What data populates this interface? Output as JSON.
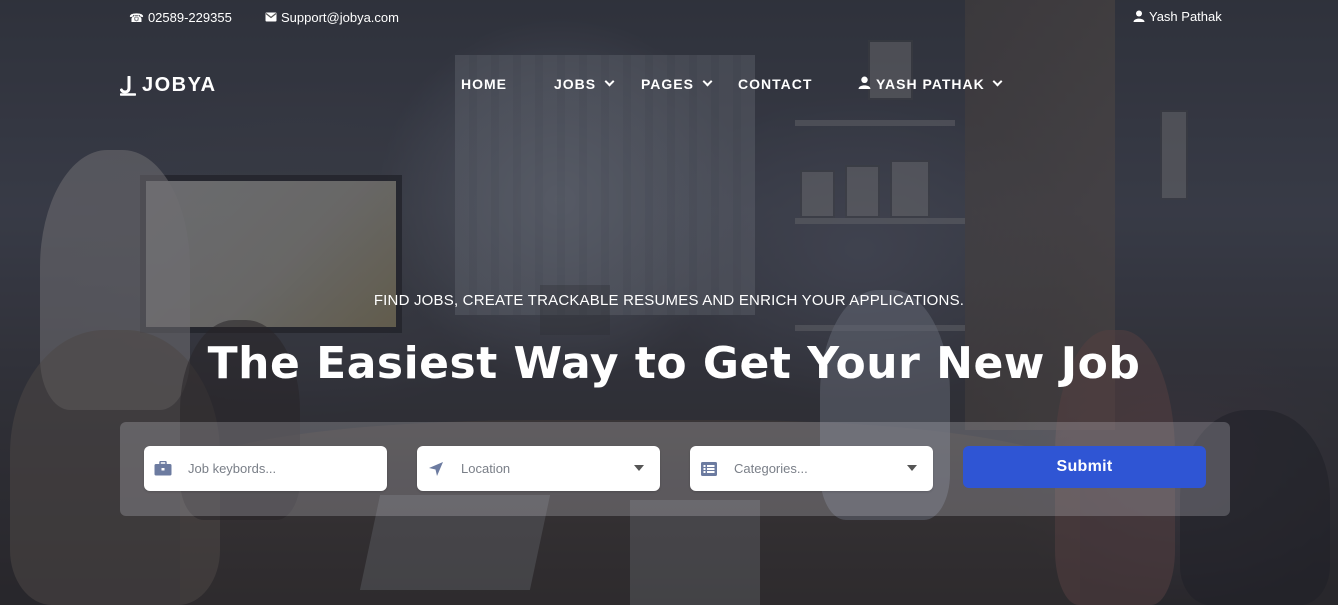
{
  "topbar": {
    "phone": "02589-229355",
    "email": "Support@jobya.com",
    "user": "Yash Pathak"
  },
  "brand": {
    "name": "JOBYA"
  },
  "nav": {
    "home": "HOME",
    "jobs": "JOBS",
    "pages": "PAGES",
    "contact": "CONTACT",
    "account": "YASH PATHAK"
  },
  "hero": {
    "tagline": "FIND JOBS, CREATE TRACKABLE RESUMES AND ENRICH YOUR APPLICATIONS.",
    "headline": "The Easiest Way to Get Your New Job"
  },
  "search": {
    "keywords_placeholder": "Job keybords...",
    "location_label": "Location",
    "categories_label": "Categories...",
    "submit_label": "Submit"
  },
  "icons": {
    "phone": "phone-icon",
    "email": "envelope-icon",
    "user": "user-icon",
    "briefcase": "briefcase-icon",
    "location": "location-arrow-icon",
    "list": "list-icon"
  },
  "colors": {
    "primary": "#2f55d4",
    "text": "#ffffff",
    "field_text": "#7a7f88"
  }
}
